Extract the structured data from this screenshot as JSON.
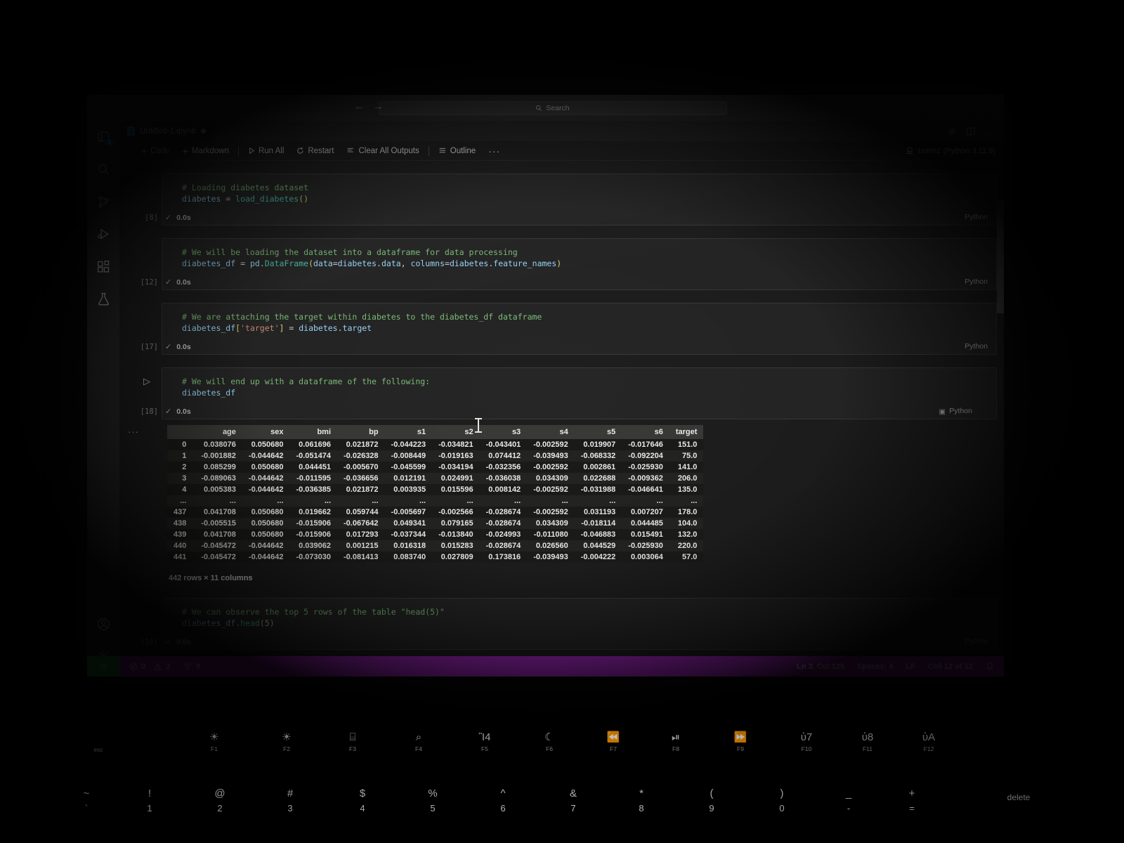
{
  "window": {
    "search_placeholder": "Search",
    "back_icon": "arrow-left-icon",
    "forward_icon": "arrow-right-icon"
  },
  "activity_bar": {
    "items": [
      {
        "name": "explorer",
        "icon": "files-icon",
        "badge": "1"
      },
      {
        "name": "search",
        "icon": "search-icon",
        "badge": ""
      },
      {
        "name": "source-control",
        "icon": "source-control-icon",
        "badge": ""
      },
      {
        "name": "run-and-debug",
        "icon": "run-debug-icon",
        "badge": ""
      },
      {
        "name": "extensions",
        "icon": "extensions-icon",
        "badge": ""
      },
      {
        "name": "testing",
        "icon": "beaker-icon",
        "badge": ""
      }
    ],
    "bottom_items": [
      {
        "name": "accounts",
        "icon": "account-icon"
      },
      {
        "name": "manage",
        "icon": "gear-icon"
      }
    ]
  },
  "tab": {
    "label": "Untitled-1.ipynb",
    "dirty": true,
    "icon": "notebook-icon"
  },
  "toolbar": {
    "code_label": "Code",
    "markdown_label": "Markdown",
    "run_all_label": "Run All",
    "restart_label": "Restart",
    "clear_all_outputs_label": "Clear All Outputs",
    "outline_label": "Outline",
    "more_label": "···",
    "kernel_label": "holim1 (Python 3.11.9)",
    "settings_icon": "gear-icon",
    "layout_icon": "split-editor-icon",
    "more_icon": "ellipsis-icon"
  },
  "cells": [
    {
      "exec_count": "[8]",
      "comment": "# Loading diabetes dataset",
      "code_var": "diabetes",
      "code_op": " = ",
      "code_fn": "load_diabetes",
      "code_paren": "()",
      "elapsed": "0.0s",
      "language": "Python"
    },
    {
      "exec_count": "[12]",
      "comment": "# We will be loading the dataset into a dataframe for data processing",
      "elapsed": "0.0s",
      "language": "Python"
    },
    {
      "exec_count": "[17]",
      "comment": "# We are attaching the target within diabetes to the diabetes_df dataframe",
      "elapsed": "0.0s",
      "language": "Python"
    },
    {
      "exec_count": "[18]",
      "comment": "# We will end up with a dataframe of the following:",
      "code_var": "diabetes_df",
      "elapsed": "0.0s",
      "language": "Python"
    },
    {
      "exec_count": "[19]",
      "comment": "# We can observe the top 5 rows of the table \"head(5)\"",
      "elapsed": "0.0s",
      "language": "Python"
    }
  ],
  "dataframe": {
    "columns": [
      "",
      "age",
      "sex",
      "bmi",
      "bp",
      "s1",
      "s2",
      "s3",
      "s4",
      "s5",
      "s6",
      "target"
    ],
    "rows": [
      [
        "0",
        "0.038076",
        "0.050680",
        "0.061696",
        "0.021872",
        "-0.044223",
        "-0.034821",
        "-0.043401",
        "-0.002592",
        "0.019907",
        "-0.017646",
        "151.0"
      ],
      [
        "1",
        "-0.001882",
        "-0.044642",
        "-0.051474",
        "-0.026328",
        "-0.008449",
        "-0.019163",
        "0.074412",
        "-0.039493",
        "-0.068332",
        "-0.092204",
        "75.0"
      ],
      [
        "2",
        "0.085299",
        "0.050680",
        "0.044451",
        "-0.005670",
        "-0.045599",
        "-0.034194",
        "-0.032356",
        "-0.002592",
        "0.002861",
        "-0.025930",
        "141.0"
      ],
      [
        "3",
        "-0.089063",
        "-0.044642",
        "-0.011595",
        "-0.036656",
        "0.012191",
        "0.024991",
        "-0.036038",
        "0.034309",
        "0.022688",
        "-0.009362",
        "206.0"
      ],
      [
        "4",
        "0.005383",
        "-0.044642",
        "-0.036385",
        "0.021872",
        "0.003935",
        "0.015596",
        "0.008142",
        "-0.002592",
        "-0.031988",
        "-0.046641",
        "135.0"
      ],
      [
        "...",
        "...",
        "...",
        "...",
        "...",
        "...",
        "...",
        "...",
        "...",
        "...",
        "...",
        "..."
      ],
      [
        "437",
        "0.041708",
        "0.050680",
        "0.019662",
        "0.059744",
        "-0.005697",
        "-0.002566",
        "-0.028674",
        "-0.002592",
        "0.031193",
        "0.007207",
        "178.0"
      ],
      [
        "438",
        "-0.005515",
        "0.050680",
        "-0.015906",
        "-0.067642",
        "0.049341",
        "0.079165",
        "-0.028674",
        "0.034309",
        "-0.018114",
        "0.044485",
        "104.0"
      ],
      [
        "439",
        "0.041708",
        "0.050680",
        "-0.015906",
        "0.017293",
        "-0.037344",
        "-0.013840",
        "-0.024993",
        "-0.011080",
        "-0.046883",
        "0.015491",
        "132.0"
      ],
      [
        "440",
        "-0.045472",
        "-0.044642",
        "0.039062",
        "0.001215",
        "0.016318",
        "0.015283",
        "-0.028674",
        "0.026560",
        "0.044529",
        "-0.025930",
        "220.0"
      ],
      [
        "441",
        "-0.045472",
        "-0.044642",
        "-0.073030",
        "-0.081413",
        "0.083740",
        "0.027809",
        "0.173816",
        "-0.039493",
        "-0.004222",
        "0.003064",
        "57.0"
      ]
    ],
    "shape_label": "442 rows × 11 columns"
  },
  "status_bar": {
    "remote_icon": "remote-window-icon",
    "errors_icon": "error-circle-icon",
    "errors": "0",
    "warnings_icon": "warning-triangle-icon",
    "warnings": "3",
    "ports_icon": "ports-icon",
    "ports": "0",
    "cursor_position": "Ln 3, Col 125",
    "indentation": "Spaces: 4",
    "eol": "LF",
    "cell_position": "Cell 12 of 12",
    "bell_icon": "bell-icon",
    "accent_color": "#a929c9"
  },
  "keyboard": {
    "fn_row": [
      {
        "key": "esc",
        "glyph": "",
        "label": "esc"
      },
      {
        "key": "f1",
        "glyph": "☀",
        "label": "F1"
      },
      {
        "key": "f2",
        "glyph": "☀",
        "label": "F2"
      },
      {
        "key": "f3",
        "glyph": "⌸",
        "label": "F3"
      },
      {
        "key": "f4",
        "glyph": "⌕",
        "label": "F4"
      },
      {
        "key": "f5",
        "glyph": "Ἲ4",
        "label": "F5"
      },
      {
        "key": "f6",
        "glyph": "☾",
        "label": "F6"
      },
      {
        "key": "f7",
        "glyph": "⏪",
        "label": "F7"
      },
      {
        "key": "f8",
        "glyph": "⏯",
        "label": "F8"
      },
      {
        "key": "f9",
        "glyph": "⏩",
        "label": "F9"
      },
      {
        "key": "f10",
        "glyph": "ὐ7",
        "label": "F10"
      },
      {
        "key": "f11",
        "glyph": "ὐ8",
        "label": "F11"
      },
      {
        "key": "f12",
        "glyph": "ὐA",
        "label": "F12"
      }
    ],
    "number_row": [
      {
        "top": "~",
        "bot": "`"
      },
      {
        "top": "!",
        "bot": "1"
      },
      {
        "top": "@",
        "bot": "2"
      },
      {
        "top": "#",
        "bot": "3"
      },
      {
        "top": "$",
        "bot": "4"
      },
      {
        "top": "%",
        "bot": "5"
      },
      {
        "top": "^",
        "bot": "6"
      },
      {
        "top": "&",
        "bot": "7"
      },
      {
        "top": "*",
        "bot": "8"
      },
      {
        "top": "(",
        "bot": "9"
      },
      {
        "top": ")",
        "bot": "0"
      },
      {
        "top": "_",
        "bot": "-"
      },
      {
        "top": "+",
        "bot": "="
      },
      {
        "top": "",
        "bot": "delete"
      }
    ]
  }
}
